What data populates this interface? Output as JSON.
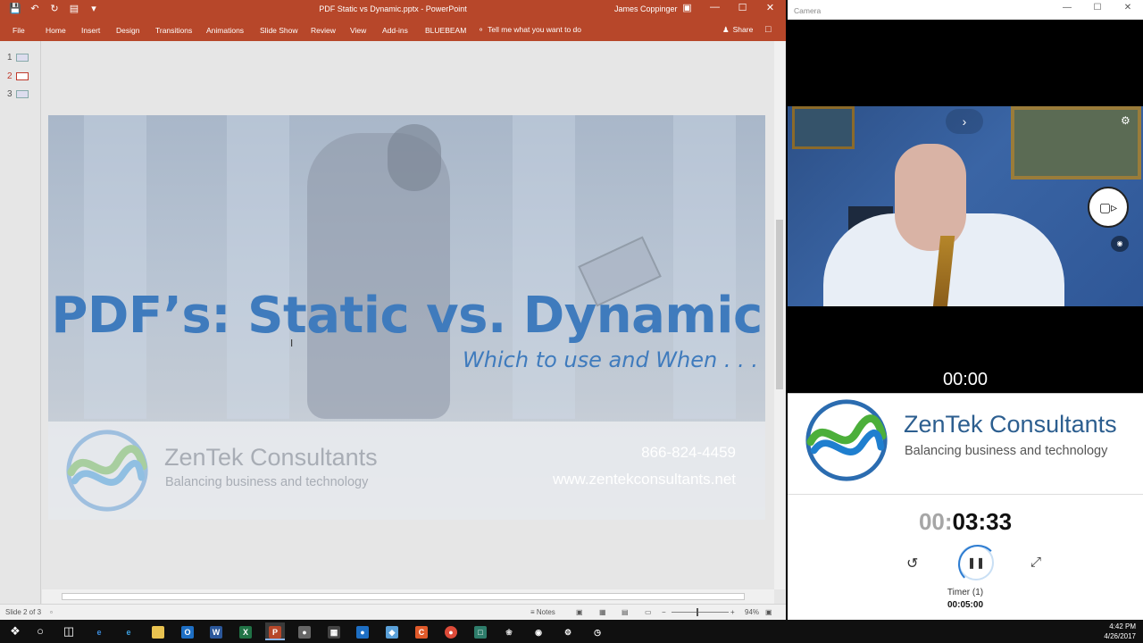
{
  "powerpoint": {
    "title": "PDF Static vs Dynamic.pptx  -  PowerPoint",
    "user": "James Coppinger",
    "tabs": [
      {
        "label": "File"
      },
      {
        "label": "Home"
      },
      {
        "label": "Insert"
      },
      {
        "label": "Design"
      },
      {
        "label": "Transitions"
      },
      {
        "label": "Animations"
      },
      {
        "label": "Slide Show"
      },
      {
        "label": "Review"
      },
      {
        "label": "View"
      },
      {
        "label": "Add-ins"
      },
      {
        "label": "BLUEBEAM"
      }
    ],
    "tell_me": "Tell me what you want to do",
    "share": "Share",
    "thumbnails": [
      {
        "number": "1"
      },
      {
        "number": "2"
      },
      {
        "number": "3"
      }
    ],
    "active_slide": 2,
    "slide": {
      "title": "PDF’s: Static vs. Dynamic",
      "subtitle": "Which to use and When . . .",
      "company": "ZenTek Consultants",
      "tagline": "Balancing business and technology",
      "phone": "866-824-4459",
      "website": "www.zentekconsultants.net"
    },
    "status": {
      "slide_info": "Slide 2 of 3",
      "notes": "Notes",
      "zoom": "94%"
    },
    "accent_color": "#b7472a"
  },
  "camera": {
    "title": "Camera",
    "recording_time": "00:00"
  },
  "logo_panel": {
    "company": "ZenTek Consultants",
    "tagline": "Balancing business and technology"
  },
  "timer": {
    "hours": "00",
    "separator1": ":",
    "minutes": "03",
    "separator2": ":",
    "seconds": "33",
    "label": "Timer (1)",
    "total": "00:05:00",
    "progress_color": "#2d7cd1"
  },
  "taskbar": {
    "time": "4:42 PM",
    "date": "4/26/2017"
  }
}
